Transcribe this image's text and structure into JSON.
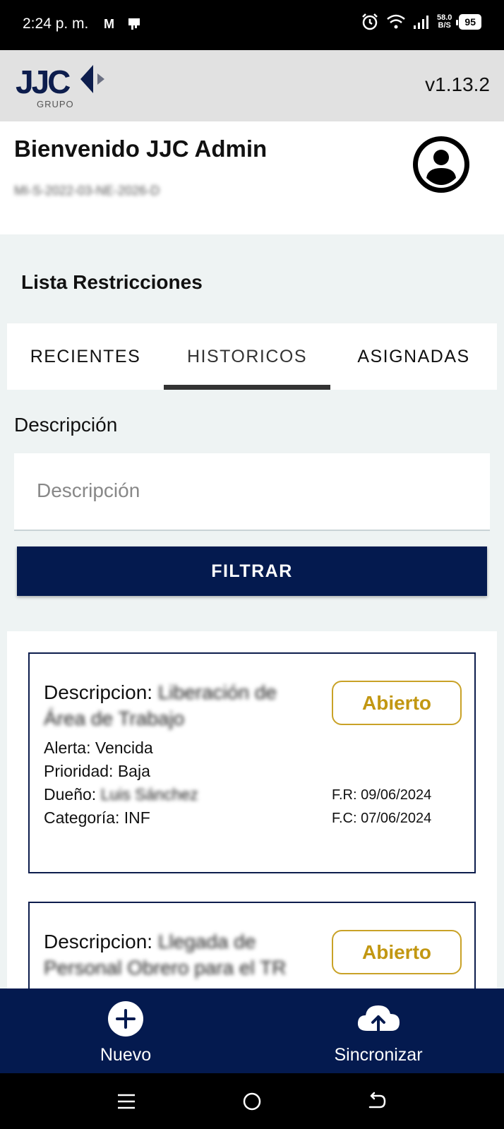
{
  "status_bar": {
    "time": "2:24 p. m.",
    "mail_glyph": "M",
    "speed_value": "58.0",
    "speed_unit": "B/S",
    "battery": "95"
  },
  "app_bar": {
    "logo_text": "JJC",
    "logo_sub": "GRUPO",
    "version": "v1.13.2"
  },
  "welcome": {
    "title": "Bienvenido JJC Admin",
    "subtitle": "MI-S-2022-03-NE-2026-D"
  },
  "list": {
    "title": "Lista Restricciones"
  },
  "tabs": [
    {
      "label": "RECIENTES"
    },
    {
      "label": "HISTORICOS"
    },
    {
      "label": "ASIGNADAS"
    }
  ],
  "filter": {
    "label": "Descripción",
    "placeholder": "Descripción",
    "value": "",
    "button": "FILTRAR"
  },
  "cards": [
    {
      "desc_label": "Descripcion:",
      "desc_value": "Liberación de Área de Trabajo",
      "status": "Abierto",
      "alert_label": "Alerta:",
      "alert_value": "Vencida",
      "priority_label": "Prioridad:",
      "priority_value": "Baja",
      "owner_label": "Dueño:",
      "owner_value": "Luis Sánchez",
      "category_label": "Categoría:",
      "category_value": "INF",
      "fr": "F.R: 09/06/2024",
      "fc": "F.C: 07/06/2024"
    },
    {
      "desc_label": "Descripcion:",
      "desc_value": "Llegada de Personal Obrero para el TR",
      "status": "Abierto"
    }
  ],
  "bottom_nav": [
    {
      "label": "Nuevo",
      "icon": "plus-circle-icon"
    },
    {
      "label": "Sincronizar",
      "icon": "cloud-upload-icon"
    }
  ],
  "colors": {
    "primary": "#041a4f",
    "status_gold": "#c29712",
    "app_bar": "#e1e1e1",
    "content_bg": "#eef3f3"
  }
}
